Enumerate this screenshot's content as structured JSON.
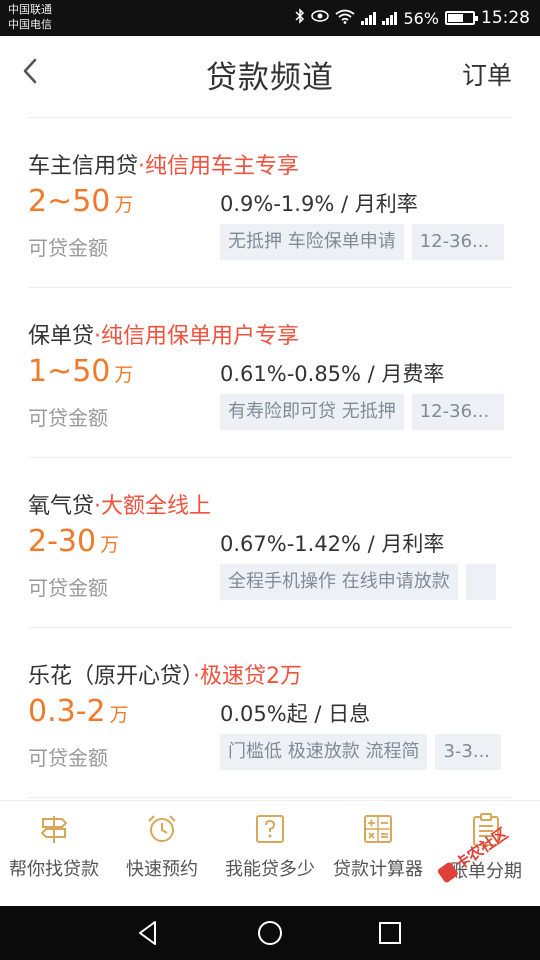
{
  "statusbar": {
    "carrier_1": "中国联通",
    "carrier_2": "中国电信",
    "battery_percent": "56%",
    "battery_level": 0.56,
    "time": "15:28",
    "icons": [
      "bluetooth-icon",
      "eye-icon",
      "wifi-icon",
      "signal-icon",
      "signal-icon",
      "battery-icon"
    ]
  },
  "header": {
    "title": "贷款频道",
    "action_label": "订单",
    "back_icon": "chevron-left-icon"
  },
  "loans": [
    {
      "name": "车主信用贷",
      "slogan": "·纯信用车主专享",
      "amount": "2~50",
      "unit": "万",
      "rate": "0.9%-1.9% / 月利率",
      "amount_label": "可贷金额",
      "tags": [
        "无抵押 车险保单申请",
        "12-36..."
      ]
    },
    {
      "name": "保单贷",
      "slogan": "·纯信用保单用户专享",
      "amount": "1~50",
      "unit": "万",
      "rate": "0.61%-0.85% / 月费率",
      "amount_label": "可贷金额",
      "tags": [
        "有寿险即可贷 无抵押",
        "12-36..."
      ]
    },
    {
      "name": "氧气贷",
      "slogan": "·大额全线上",
      "amount": "2-30",
      "unit": "万",
      "rate": "0.67%-1.42% / 月利率",
      "amount_label": "可贷金额",
      "tags": [
        "全程手机操作 在线申请放款",
        ""
      ]
    },
    {
      "name": "乐花（原开心贷）",
      "slogan": "·极速贷2万",
      "amount": "0.3-2",
      "unit": "万",
      "rate": "0.05%起 / 日息",
      "amount_label": "可贷金额",
      "tags": [
        "门槛低 极速放款 流程简",
        "3-3..."
      ]
    }
  ],
  "tabbar": {
    "items": [
      {
        "label": "帮你找贷款",
        "icon": "signpost-icon"
      },
      {
        "label": "快速预约",
        "icon": "alarm-clock-icon"
      },
      {
        "label": "我能贷多少",
        "icon": "question-icon"
      },
      {
        "label": "贷款计算器",
        "icon": "calculator-icon"
      },
      {
        "label": "账单分期",
        "icon": "clipboard-icon"
      }
    ]
  },
  "watermark": {
    "text": "卡农社区"
  },
  "navbar": {
    "buttons": [
      "back-triangle-icon",
      "home-circle-icon",
      "recents-square-icon"
    ]
  },
  "colors": {
    "accent_orange": "#f07a2a",
    "accent_red": "#f0523e",
    "tag_bg": "#edf1f5",
    "tag_text": "#7f8b98",
    "icon_gold": "#d9a75a"
  }
}
